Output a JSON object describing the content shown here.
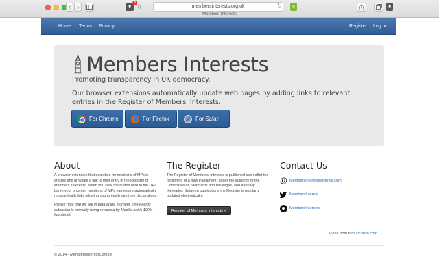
{
  "browser": {
    "url": "membersinterests.org.uk",
    "tab_title": "Members Interests",
    "back_glyph": "‹",
    "forward_glyph": "›",
    "extension_badge": "3",
    "icons": [
      "back-icon",
      "forward-icon",
      "sidebar-icon",
      "extension-icon",
      "reload-icon",
      "share-icon",
      "tabs-icon"
    ]
  },
  "nav": {
    "left": [
      "Home",
      "Terms",
      "Privacy"
    ],
    "right": [
      "Register",
      "Log In"
    ]
  },
  "hero": {
    "title": "Members Interests",
    "subtitle": "Promoting transparency in UK democracy.",
    "description": "Our browser extensions automatically update web pages by adding links to relevant entries in the Register of Members' Interests.",
    "buttons": [
      "For Chrome",
      "For Firefox",
      "For Safari"
    ]
  },
  "about": {
    "heading": "About",
    "p1": "A browser extension that searches for mentions of MPs in articles and provides a link to their entry in the Register of Members' Interests. When you click the button next to the URL bar in your browser, mentions of MPs names are automatically replaced with links allowing you to easily see their declarations.",
    "p2": "Please note that we are in beta at the moment. The Firefox extension is currently being reviewed by Mozilla but is 100% functional."
  },
  "register": {
    "heading": "The Register",
    "p1": "The Register of Members' Interests is published soon after the beginning of a new Parliament, under the authority of the Committee on Standards and Privileges, and annually thereafter. Between publications the Register is regularly updated electronically.",
    "button": "Register of Members Interests »"
  },
  "contact": {
    "heading": "Contact Us",
    "email": "Membersinterests@gmail.com",
    "twitter": "MembersInterest",
    "github": "MembersInterests"
  },
  "credit": {
    "prefix": "Icons from ",
    "link": "http://icons8.com"
  },
  "footer": {
    "text": "© 2014 - MembersInterests.org.uk"
  }
}
